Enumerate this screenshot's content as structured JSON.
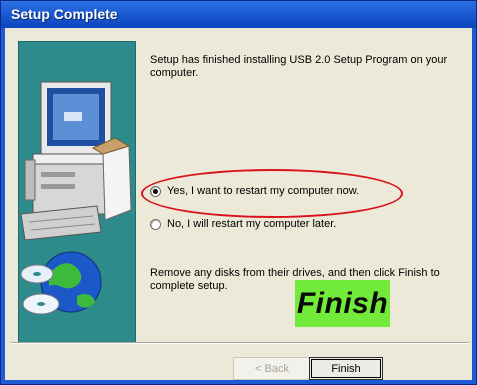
{
  "window": {
    "title": "Setup Complete"
  },
  "content": {
    "message": "Setup has finished installing USB 2.0 Setup Program on your computer.",
    "options": [
      {
        "label": "Yes, I want to restart my computer now.",
        "selected": true
      },
      {
        "label": "No, I will restart my computer later.",
        "selected": false
      }
    ],
    "instruction": "Remove any disks from their drives, and then click Finish to complete setup."
  },
  "annotation": {
    "callout_label": "Finish",
    "highlight_color": "#d9111b",
    "callout_color": "#71ea3a"
  },
  "buttons": {
    "back_label": "< Back",
    "finish_label": "Finish"
  },
  "icons": [
    "computer-illustration-icon",
    "globe-icon",
    "cd-disc-icon"
  ]
}
